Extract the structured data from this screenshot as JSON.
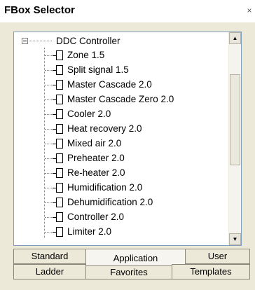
{
  "window": {
    "title": "FBox Selector",
    "close_glyph": "×"
  },
  "tree": {
    "root_label": "DDC Controller",
    "items": [
      {
        "label": "Zone 1.5"
      },
      {
        "label": "Split signal 1.5"
      },
      {
        "label": "Master Cascade 2.0"
      },
      {
        "label": "Master Cascade Zero 2.0"
      },
      {
        "label": "Cooler 2.0"
      },
      {
        "label": "Heat recovery 2.0"
      },
      {
        "label": "Mixed air 2.0"
      },
      {
        "label": "Preheater 2.0"
      },
      {
        "label": "Re-heater 2.0"
      },
      {
        "label": "Humidification 2.0"
      },
      {
        "label": "Dehumidification 2.0"
      },
      {
        "label": "Controller 2.0"
      },
      {
        "label": "Limiter 2.0"
      }
    ]
  },
  "scrollbar": {
    "up_glyph": "▲",
    "down_glyph": "▼"
  },
  "tabs": {
    "row1": [
      {
        "label": "Standard"
      },
      {
        "label": "Application",
        "active": true
      },
      {
        "label": "User"
      }
    ],
    "row2": [
      {
        "label": "Ladder"
      },
      {
        "label": "Favorites"
      },
      {
        "label": "Templates"
      }
    ]
  }
}
